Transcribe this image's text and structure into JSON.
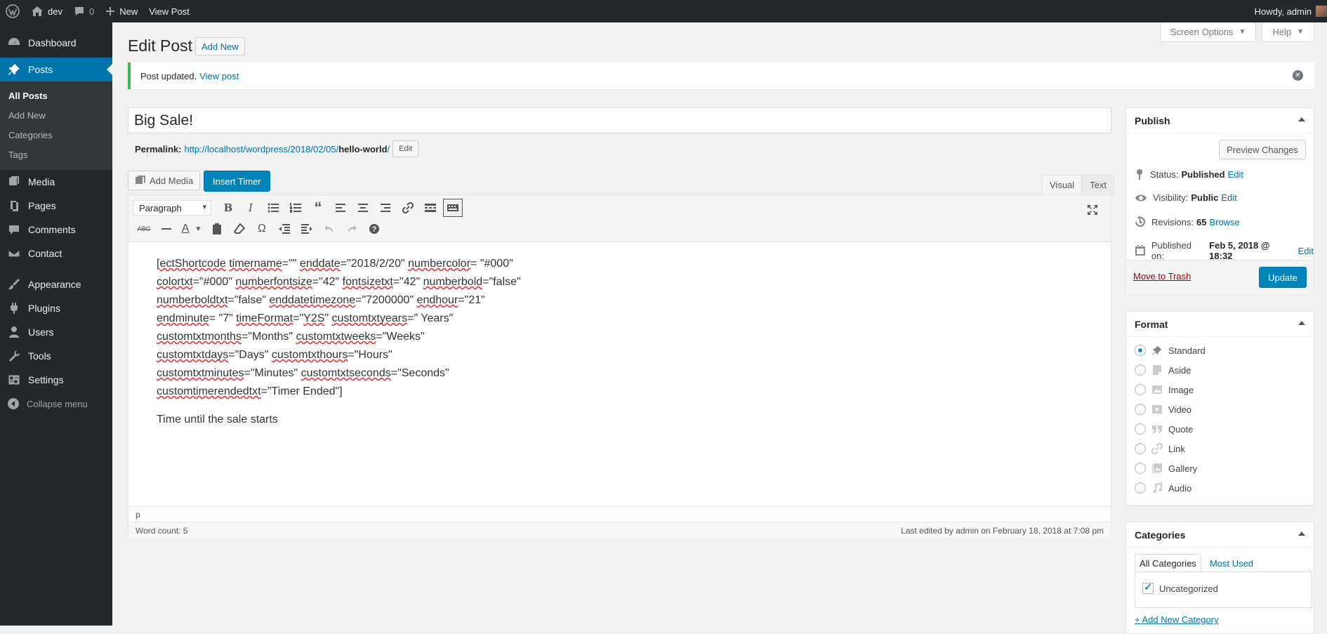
{
  "adminbar": {
    "site_name": "dev",
    "comments_count": "0",
    "new_label": "New",
    "view_post_label": "View Post",
    "howdy": "Howdy, admin"
  },
  "sidebar": {
    "dashboard": "Dashboard",
    "posts": "Posts",
    "posts_sub": [
      "All Posts",
      "Add New",
      "Categories",
      "Tags"
    ],
    "media": "Media",
    "pages": "Pages",
    "comments": "Comments",
    "contact": "Contact",
    "appearance": "Appearance",
    "plugins": "Plugins",
    "users": "Users",
    "tools": "Tools",
    "settings": "Settings",
    "collapse": "Collapse menu"
  },
  "screen_meta": {
    "screen_options": "Screen Options",
    "help": "Help"
  },
  "header": {
    "title": "Edit Post",
    "add_new": "Add New"
  },
  "notice": {
    "text": "Post updated.",
    "link": "View post"
  },
  "post": {
    "title": "Big Sale!",
    "permalink_label": "Permalink:",
    "permalink_base": "http://localhost/wordpress/2018/02/05/",
    "permalink_slug": "hello-world",
    "permalink_trail": "/",
    "permalink_edit": "Edit"
  },
  "editor": {
    "add_media": "Add Media",
    "insert_timer": "Insert Timer",
    "tab_visual": "Visual",
    "tab_text": "Text",
    "format_select": "Paragraph",
    "content_lines": [
      [
        "[",
        "ectShortcode",
        " ",
        "timername",
        "=\"\" ",
        "enddate",
        "=\"2018/2/20\" ",
        "numbercolor",
        "= \"#000\""
      ],
      [
        "",
        "colortxt",
        "=\"#000\" ",
        "numberfontsize",
        "=\"42\" ",
        "fontsizetxt",
        "=\"42\" ",
        "numberbold",
        "=\"false\""
      ],
      [
        "",
        "numberboldtxt",
        "=\"false\" ",
        "enddatetimezone",
        "=\"7200000\" ",
        "endhour",
        "=\"21\""
      ],
      [
        "",
        "endminute",
        "= \"7\" ",
        "timeFormat",
        "=\"",
        "Y2S",
        "\" ",
        "customtxtyears",
        "=\" Years\""
      ],
      [
        "",
        "customtxtmonths",
        "=\"Months\" ",
        "customtxtweeks",
        "=\"Weeks\""
      ],
      [
        "",
        "customtxtdays",
        "=\"Days\" ",
        "customtxthours",
        "=\"Hours\""
      ],
      [
        "",
        "customtxtminutes",
        "=\"Minutes\" ",
        "customtxtseconds",
        "=\"Seconds\""
      ],
      [
        "",
        "customtimerendedtxt",
        "=\"Timer Ended\"]"
      ]
    ],
    "paragraph2": "Time until the sale starts",
    "path": "p",
    "word_count": "Word count: 5",
    "last_edited": "Last edited by admin on February 18, 2018 at 7:08 pm"
  },
  "publish": {
    "title": "Publish",
    "preview": "Preview Changes",
    "status_label": "Status:",
    "status_value": "Published",
    "visibility_label": "Visibility:",
    "visibility_value": "Public",
    "revisions_label": "Revisions:",
    "revisions_value": "65",
    "browse": "Browse",
    "published_label": "Published on:",
    "published_value": "Feb 5, 2018 @ 18:32",
    "edit": "Edit",
    "trash": "Move to Trash",
    "update": "Update"
  },
  "format": {
    "title": "Format",
    "options": [
      "Standard",
      "Aside",
      "Image",
      "Video",
      "Quote",
      "Link",
      "Gallery",
      "Audio"
    ],
    "selected": "Standard"
  },
  "categories": {
    "title": "Categories",
    "tab_all": "All Categories",
    "tab_most": "Most Used",
    "items": [
      "Uncategorized"
    ],
    "add_new": "+ Add New Category"
  },
  "colors": {
    "accent": "#0073aa",
    "primary_button": "#0085ba",
    "notice_success": "#46b450",
    "adminbar": "#23282d",
    "trash": "#a00"
  }
}
